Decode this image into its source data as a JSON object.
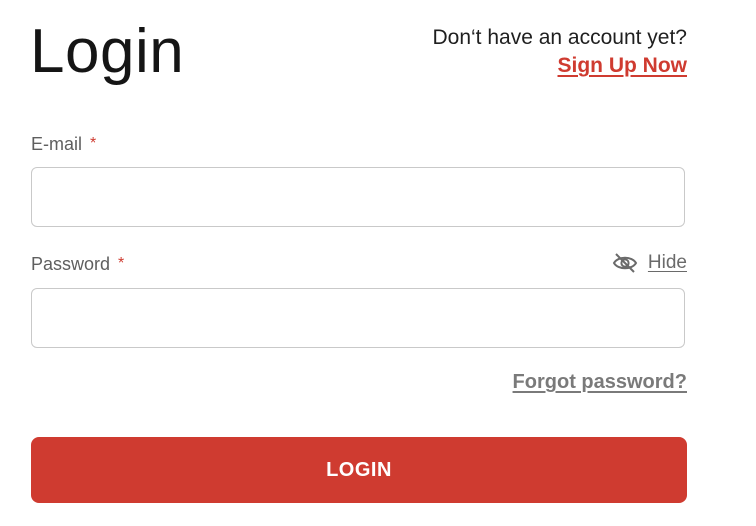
{
  "header": {
    "title": "Login",
    "signup_prompt": "Don‘t have an account yet?",
    "signup_link": "Sign Up Now"
  },
  "form": {
    "email": {
      "label": "E-mail",
      "required_mark": "*",
      "value": "",
      "placeholder": ""
    },
    "password": {
      "label": "Password",
      "required_mark": "*",
      "value": "",
      "placeholder": "",
      "toggle_label": "Hide",
      "toggle_icon": "eye-off-icon"
    },
    "forgot_password": "Forgot password?",
    "submit_label": "LOGIN"
  },
  "colors": {
    "accent": "#cf3b30",
    "label": "#5f5f5f",
    "border": "#c9c9c9"
  }
}
